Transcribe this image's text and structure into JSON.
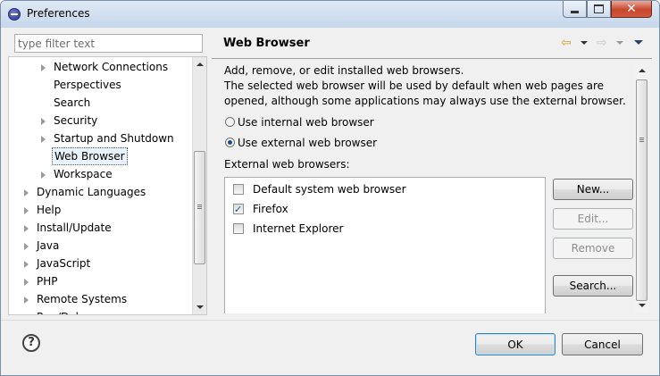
{
  "window": {
    "title": "Preferences",
    "close_glyph": "✕"
  },
  "filter": {
    "placeholder": "type filter text",
    "value": ""
  },
  "tree": {
    "items": [
      {
        "label": "Network Connections",
        "level": 1,
        "expandable": true,
        "selected": false
      },
      {
        "label": "Perspectives",
        "level": 1,
        "expandable": false,
        "selected": false
      },
      {
        "label": "Search",
        "level": 1,
        "expandable": false,
        "selected": false
      },
      {
        "label": "Security",
        "level": 1,
        "expandable": true,
        "selected": false
      },
      {
        "label": "Startup and Shutdown",
        "level": 1,
        "expandable": true,
        "selected": false
      },
      {
        "label": "Web Browser",
        "level": 1,
        "expandable": false,
        "selected": true
      },
      {
        "label": "Workspace",
        "level": 1,
        "expandable": true,
        "selected": false
      },
      {
        "label": "Dynamic Languages",
        "level": 0,
        "expandable": true,
        "selected": false
      },
      {
        "label": "Help",
        "level": 0,
        "expandable": true,
        "selected": false
      },
      {
        "label": "Install/Update",
        "level": 0,
        "expandable": true,
        "selected": false
      },
      {
        "label": "Java",
        "level": 0,
        "expandable": true,
        "selected": false
      },
      {
        "label": "JavaScript",
        "level": 0,
        "expandable": true,
        "selected": false
      },
      {
        "label": "PHP",
        "level": 0,
        "expandable": true,
        "selected": false
      },
      {
        "label": "Remote Systems",
        "level": 0,
        "expandable": true,
        "selected": false
      },
      {
        "label": "Run/Debug",
        "level": 0,
        "expandable": true,
        "selected": false
      }
    ]
  },
  "page": {
    "title": "Web Browser",
    "description": "Add, remove, or edit installed web browsers.\nThe selected web browser will be used by default when web pages are opened, although some applications may always use the external browser.",
    "radio_internal": "Use internal web browser",
    "radio_external": "Use external web browser",
    "selected_radio": "external",
    "browsers_label": "External web browsers:",
    "browsers": [
      {
        "label": "Default system web browser",
        "checked": false
      },
      {
        "label": "Firefox",
        "checked": true
      },
      {
        "label": "Internet Explorer",
        "checked": false
      }
    ],
    "buttons": {
      "new": "New...",
      "edit": "Edit...",
      "remove": "Remove",
      "search": "Search..."
    }
  },
  "nav": {
    "back_icon": "⇦",
    "forward_icon": "⇨"
  },
  "footer": {
    "help_glyph": "?",
    "ok": "OK",
    "cancel": "Cancel"
  },
  "colors": {
    "accent": "#3c7fb1",
    "selection": "#e8f2fc",
    "disabled_text": "#8d8d8d"
  }
}
